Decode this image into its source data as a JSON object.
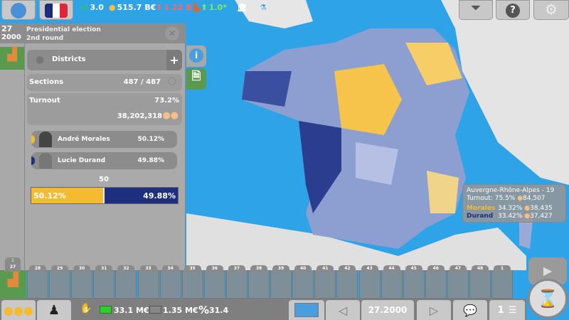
{
  "top": {
    "happiness": "3.0",
    "treasury": "515.7 B€",
    "deficit": "1.22 B",
    "growth": "1.0*",
    "country_flag": "France"
  },
  "header": {
    "day": "27",
    "year": "2000",
    "title": "Presidential election",
    "subtitle": "2nd round"
  },
  "panel": {
    "districts_label": "Districts",
    "sections_label": "Sections",
    "sections_value": "487 / 487",
    "turnout_label": "Turnout",
    "turnout_pct": "73.2%",
    "turnout_votes": "38,202,318",
    "candidates": [
      {
        "name": "André Morales",
        "pct": "50.12%",
        "color": "#f4bb30"
      },
      {
        "name": "Lucie Durand",
        "pct": "49.88%",
        "color": "#1e2f80"
      }
    ],
    "bar": {
      "midpoint": "50",
      "left": "50.12%",
      "right": "49.88%",
      "left_fraction": 0.5012
    }
  },
  "tooltip": {
    "region": "Auvergne-Rhône-Alpes - 19",
    "turnout": "Turnout: 75.5%",
    "turnout_votes": "84,507",
    "rows": [
      {
        "name": "Morales",
        "pct": "34.32%",
        "votes": "38,435",
        "color": "#f4bb30"
      },
      {
        "name": "Durand",
        "pct": "33.42%",
        "votes": "37,427",
        "color": "#1e2f80"
      }
    ]
  },
  "timeline": {
    "current_badge": "1",
    "current": "27",
    "days": [
      "28",
      "29",
      "30",
      "31",
      "32",
      "33",
      "34",
      "35",
      "36",
      "37",
      "38",
      "39",
      "40",
      "41",
      "42",
      "43",
      "44",
      "45",
      "46",
      "47",
      "48",
      "1"
    ]
  },
  "bottom": {
    "actions": "1",
    "money1": "33.1 M€",
    "money2": "1.35 M€",
    "pct": "31.4",
    "date": "27.2000",
    "messages": "1"
  }
}
